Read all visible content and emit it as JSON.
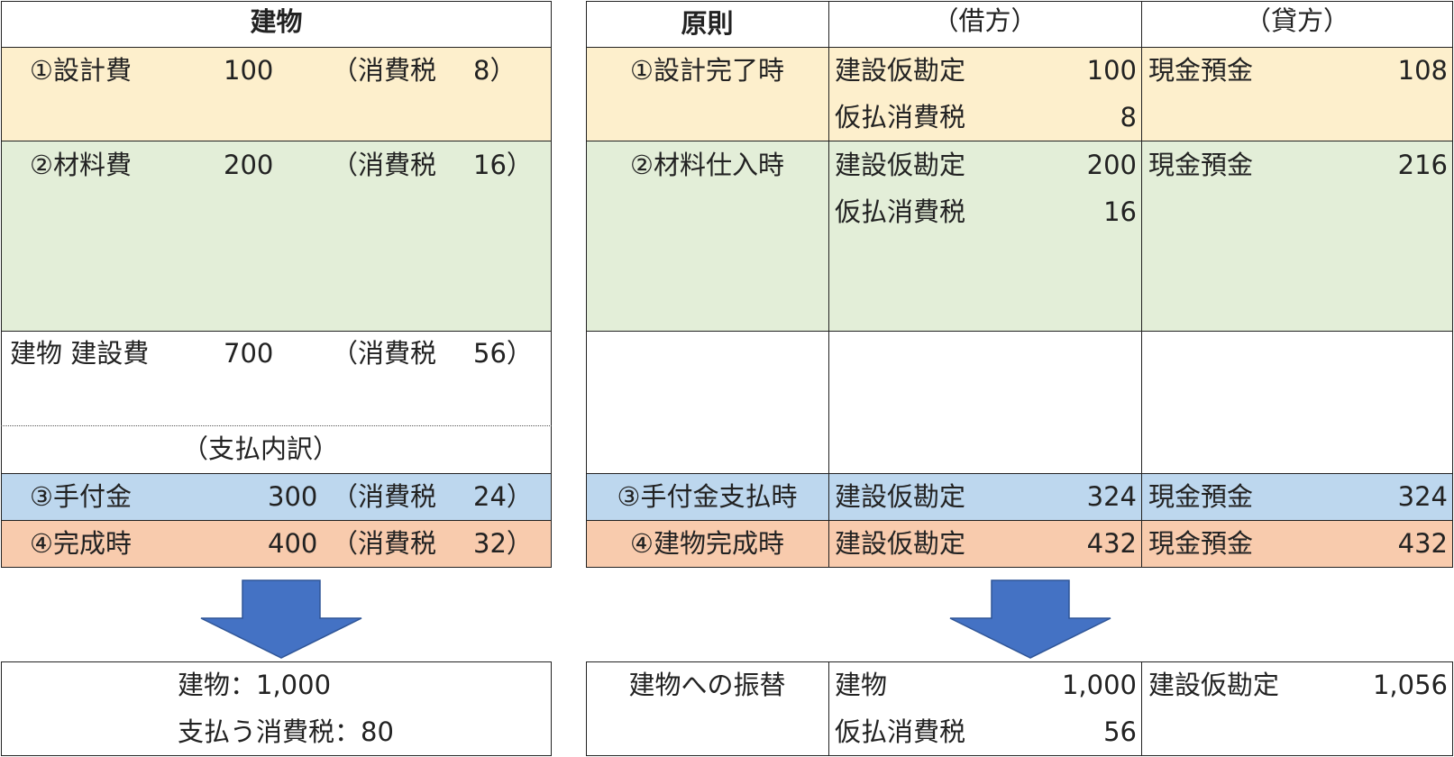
{
  "colors": {
    "yellow": "#fdefcc",
    "green": "#e3eed8",
    "blue": "#bdd7ee",
    "orange": "#f8cbad",
    "arrow": "#4472c4",
    "arrow_border": "#2f5597",
    "border": "#222222"
  },
  "left": {
    "header": "建物",
    "rows": [
      {
        "label": "①設計費",
        "amount": "100",
        "tax_label": "（消費税",
        "tax_value": "8）"
      },
      {
        "label": "②材料費",
        "amount": "200",
        "tax_label": "（消費税",
        "tax_value": "16）"
      },
      {
        "label": "建物 建設費",
        "amount": "700",
        "tax_label": "（消費税",
        "tax_value": "56）"
      },
      {
        "label": "③手付金",
        "amount": "300",
        "tax_label": "（消費税",
        "tax_value": "24）"
      },
      {
        "label": "④完成時",
        "amount": "400",
        "tax_label": "（消費税",
        "tax_value": "32）"
      }
    ],
    "breakdown": "（支払内訳）"
  },
  "right": {
    "headers": {
      "principle": "原則",
      "debit": "（借方）",
      "credit": "（貸方）"
    },
    "rows": [
      {
        "event": "①設計完了時",
        "debits": [
          {
            "account": "建設仮勘定",
            "amount": "100"
          },
          {
            "account": "仮払消費税",
            "amount": "8"
          }
        ],
        "credit_account": "現金預金",
        "credit_amount": "108"
      },
      {
        "event": "②材料仕入時",
        "debits": [
          {
            "account": "建設仮勘定",
            "amount": "200"
          },
          {
            "account": "仮払消費税",
            "amount": "16"
          }
        ],
        "credit_account": "現金預金",
        "credit_amount": "216"
      },
      {
        "event": "③手付金支払時",
        "debits": [
          {
            "account": "建設仮勘定",
            "amount": "324"
          }
        ],
        "credit_account": "現金預金",
        "credit_amount": "324"
      },
      {
        "event": "④建物完成時",
        "debits": [
          {
            "account": "建設仮勘定",
            "amount": "432"
          }
        ],
        "credit_account": "現金預金",
        "credit_amount": "432"
      }
    ]
  },
  "bottom_left": {
    "line1": "建物：1,000",
    "line2": "支払う消費税：80"
  },
  "bottom_right": {
    "event": "建物への振替",
    "debits": [
      {
        "account": "建物",
        "amount": "1,000"
      },
      {
        "account": "仮払消費税",
        "amount": "56"
      }
    ],
    "credit_account": "建設仮勘定",
    "credit_amount": "1,056"
  },
  "icons": {
    "arrow": "down-arrow-icon"
  }
}
